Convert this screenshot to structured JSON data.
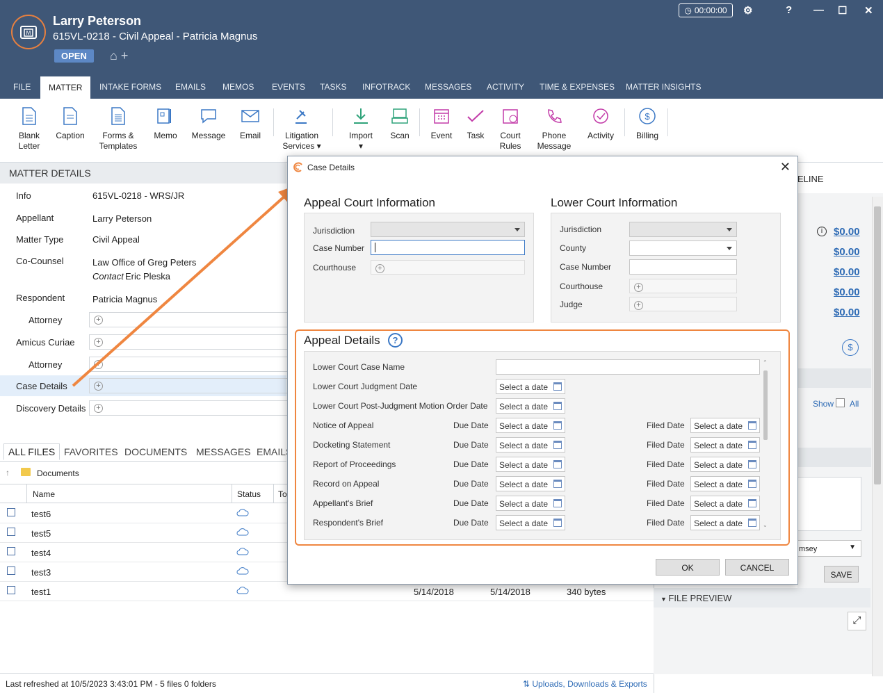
{
  "header": {
    "client_name": "Larry Peterson",
    "matter_title": "615VL-0218 - Civil Appeal - Patricia Magnus",
    "status_badge": "OPEN",
    "timer": "00:00:00",
    "help": "?"
  },
  "tabs": [
    "FILE",
    "MATTER",
    "INTAKE FORMS",
    "EMAILS",
    "MEMOS",
    "EVENTS",
    "TASKS",
    "INFOTRACK",
    "MESSAGES",
    "ACTIVITY",
    "TIME & EXPENSES",
    "MATTER INSIGHTS"
  ],
  "ribbon": {
    "blank_letter": [
      "Blank",
      "Letter"
    ],
    "caption": "Caption",
    "forms": [
      "Forms &",
      "Templates"
    ],
    "memo": "Memo",
    "message": "Message",
    "email": "Email",
    "litigation": [
      "Litigation",
      "Services ▾"
    ],
    "import": "Import",
    "scan": "Scan",
    "event": "Event",
    "task": "Task",
    "court_rules": [
      "Court",
      "Rules"
    ],
    "phone_message": [
      "Phone",
      "Message"
    ],
    "activity": "Activity",
    "billing": "Billing"
  },
  "matter_details": {
    "heading": "MATTER DETAILS",
    "info_label": "Info",
    "info_value": "615VL-0218 - WRS/JR",
    "appellant_label": "Appellant",
    "appellant_value": "Larry Peterson",
    "matter_type_label": "Matter Type",
    "matter_type_value": "Civil Appeal",
    "cocounsel_label": "Co-Counsel",
    "cocounsel_value": "Law Office of Greg Peters",
    "contact_prefix": "Contact",
    "contact_name": "Eric Pleska",
    "respondent_label": "Respondent",
    "respondent_value": "Patricia Magnus",
    "attorney_label": "Attorney",
    "amicus_label": "Amicus Curiae",
    "case_details_label": "Case Details",
    "discovery_label": "Discovery Details"
  },
  "files": {
    "tabs": [
      "ALL FILES",
      "FAVORITES",
      "DOCUMENTS",
      "MESSAGES",
      "EMAILS"
    ],
    "folder": "Documents",
    "col_name": "Name",
    "col_status": "Status",
    "col_to": "To",
    "rows": [
      "test6",
      "test5",
      "test4",
      "test3",
      "test1"
    ],
    "last_row_date1": "5/14/2018",
    "last_row_date2": "5/14/2018",
    "last_row_size": "340 bytes",
    "status_text": "Last refreshed at 10/5/2023 3:43:01 PM  -  5 files  0 folders",
    "uploads_link": "Uploads, Downloads & Exports"
  },
  "right_panel": {
    "timeline": "ELINE",
    "money": [
      "$0.00",
      "$0.00",
      "$0.00",
      "$0.00",
      "$0.00"
    ],
    "show": "Show",
    "all": "All",
    "select_tail": "msey",
    "save": "SAVE",
    "file_preview": "FILE PREVIEW"
  },
  "dialog": {
    "title": "Case Details",
    "appeal_court_title": "Appeal Court Information",
    "lower_court_title": "Lower Court Information",
    "jurisdiction": "Jurisdiction",
    "case_number": "Case Number",
    "courthouse": "Courthouse",
    "county": "County",
    "judge": "Judge",
    "appeal_details_title": "Appeal Details",
    "help": "?",
    "lower_case_name": "Lower Court Case Name",
    "lower_judgment_date": "Lower Court Judgment Date",
    "post_judgment": "Lower Court Post-Judgment Motion Order Date",
    "due_date": "Due Date",
    "filed_date": "Filed Date",
    "date_placeholder": "Select a date",
    "items": [
      "Notice of Appeal",
      "Docketing Statement",
      "Report of Proceedings",
      "Record on Appeal",
      "Appellant's Brief",
      "Respondent's Brief"
    ],
    "ok": "OK",
    "cancel": "CANCEL"
  },
  "colors": {
    "header": "#3f5777",
    "accent": "#ef8640",
    "link": "#2e6bb5"
  }
}
